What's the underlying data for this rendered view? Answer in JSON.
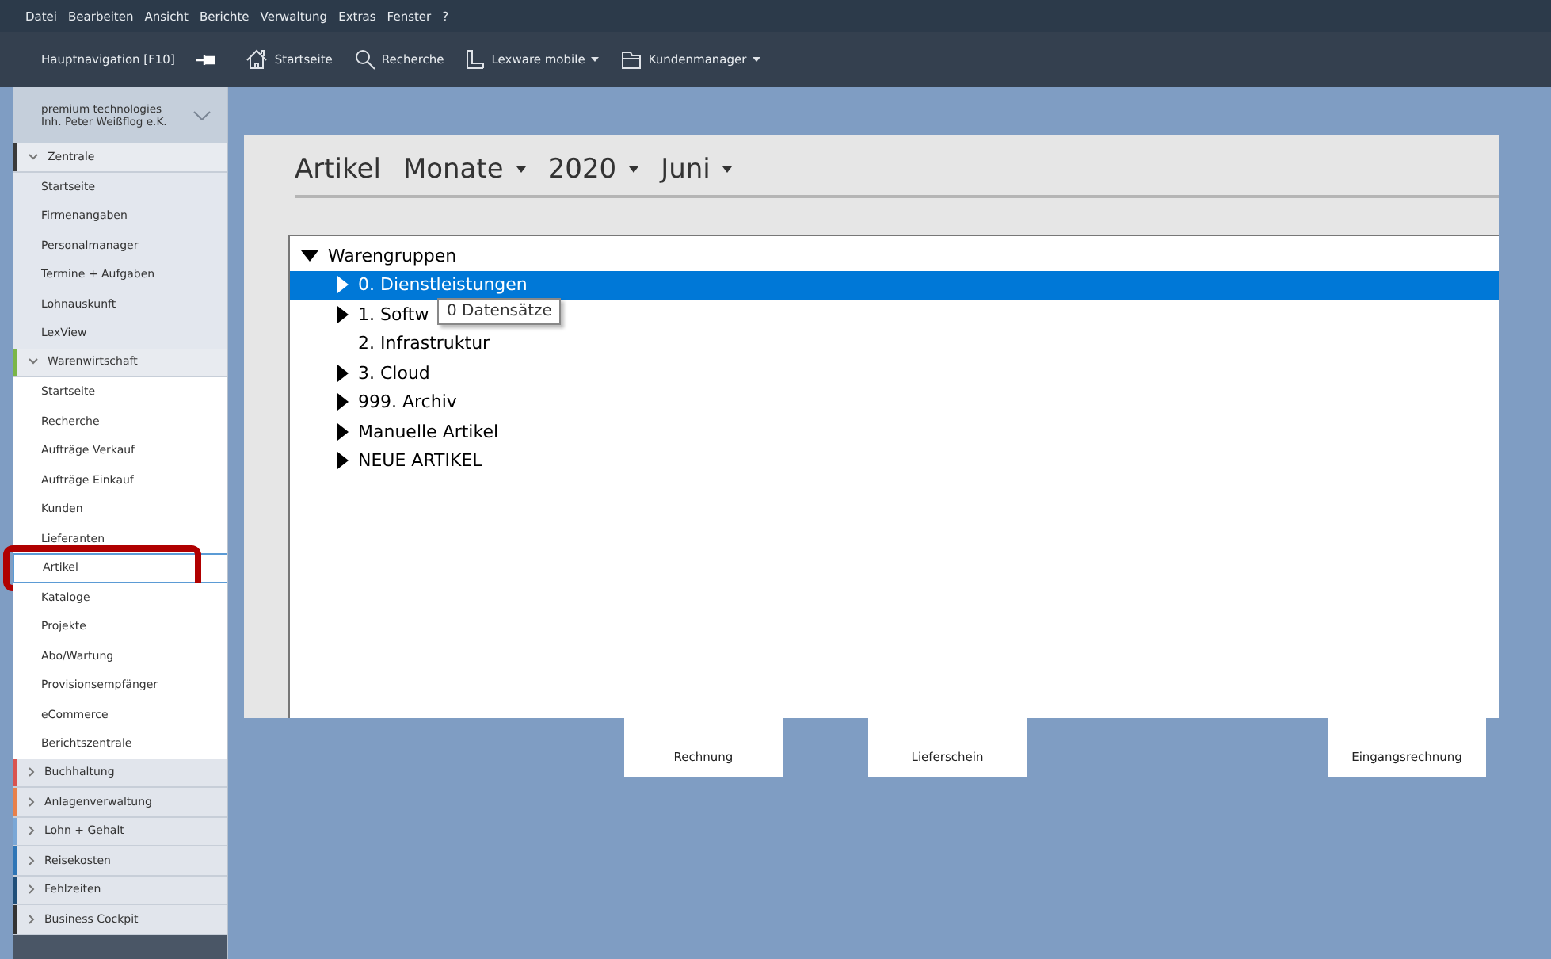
{
  "menu": [
    "Datei",
    "Bearbeiten",
    "Ansicht",
    "Berichte",
    "Verwaltung",
    "Extras",
    "Fenster",
    "?"
  ],
  "toolbar": {
    "nav_label": "Hauptnavigation [F10]",
    "items": [
      {
        "kind": "home",
        "label": "Startseite",
        "dropdown": false
      },
      {
        "kind": "search",
        "label": "Recherche",
        "dropdown": false
      },
      {
        "kind": "mobile",
        "label": "Lexware mobile",
        "dropdown": true
      },
      {
        "kind": "crm",
        "label": "Kundenmanager",
        "dropdown": true
      }
    ]
  },
  "sidebar": {
    "company": [
      "premium technologies",
      "Inh. Peter Weißflog e.K."
    ],
    "sections": [
      {
        "label": "Zentrale",
        "color": "#3a3a3a",
        "expanded": true,
        "items": [
          {
            "label": "Startseite",
            "selected": false
          },
          {
            "label": "Firmenangaben",
            "selected": false
          },
          {
            "label": "Personalmanager",
            "selected": false
          },
          {
            "label": "Termine + Aufgaben",
            "selected": false
          },
          {
            "label": "Lohnauskunft",
            "selected": false
          },
          {
            "label": "LexView",
            "selected": false
          }
        ]
      },
      {
        "label": "Warenwirtschaft",
        "color": "#7ab648",
        "expanded": true,
        "items": [
          {
            "label": "Startseite",
            "selected": false
          },
          {
            "label": "Recherche",
            "selected": false
          },
          {
            "label": "Aufträge Verkauf",
            "selected": false
          },
          {
            "label": "Aufträge Einkauf",
            "selected": false
          },
          {
            "label": "Kunden",
            "selected": false
          },
          {
            "label": "Lieferanten",
            "selected": false
          },
          {
            "label": "Artikel",
            "selected": true
          },
          {
            "label": "Kataloge",
            "selected": false
          },
          {
            "label": "Projekte",
            "selected": false
          },
          {
            "label": "Abo/Wartung",
            "selected": false
          },
          {
            "label": "Provisionsempfänger",
            "selected": false
          },
          {
            "label": "eCommerce",
            "selected": false
          },
          {
            "label": "Berichtszentrale",
            "selected": false
          }
        ]
      },
      {
        "label": "Buchhaltung",
        "color": "#d9534f",
        "expanded": false
      },
      {
        "label": "Anlagenverwaltung",
        "color": "#e8804a",
        "expanded": false
      },
      {
        "label": "Lohn + Gehalt",
        "color": "#7aa7d6",
        "expanded": false
      },
      {
        "label": "Reisekosten",
        "color": "#2e75b6",
        "expanded": false
      },
      {
        "label": "Fehlzeiten",
        "color": "#1f4e79",
        "expanded": false
      },
      {
        "label": "Business Cockpit",
        "color": "#333333",
        "expanded": false
      }
    ]
  },
  "panel": {
    "title": "Artikel",
    "filters": [
      "Monate",
      "2020",
      "Juni"
    ],
    "tree": {
      "label": "Warengruppen",
      "expanded": true,
      "children": [
        {
          "label": "0. Dienstleistungen",
          "has_children": true,
          "selected": true
        },
        {
          "label": "1. Softw",
          "has_children": true,
          "selected": false
        },
        {
          "label": "2. Infrastruktur",
          "has_children": false,
          "selected": false
        },
        {
          "label": "3. Cloud",
          "has_children": true,
          "selected": false
        },
        {
          "label": "999. Archiv",
          "has_children": true,
          "selected": false
        },
        {
          "label": "Manuelle Artikel",
          "has_children": true,
          "selected": false
        },
        {
          "label": "NEUE ARTIKEL",
          "has_children": true,
          "selected": false
        }
      ]
    },
    "tooltip": "0 Datensätze"
  },
  "tiles": [
    "Rechnung",
    "Lieferschein",
    "Eingangsrechnung"
  ]
}
